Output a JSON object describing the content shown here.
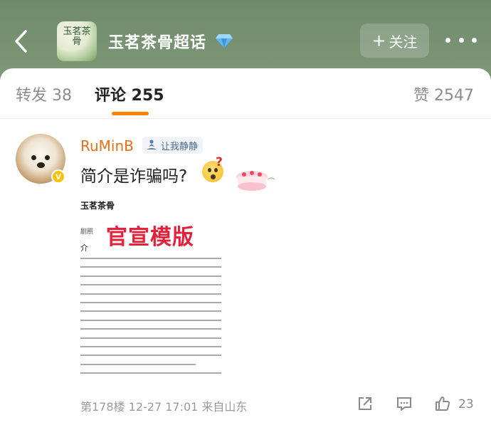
{
  "header": {
    "logo_text": "玉茗茶骨",
    "title": "玉茗茶骨超话",
    "follow_label": "关注"
  },
  "tabs": [
    {
      "label": "转发 38"
    },
    {
      "label": "评论 255"
    },
    {
      "label": "赞 2547"
    }
  ],
  "colors": {
    "accent": "#ff8200",
    "header_bg": "#76916f",
    "username": "#e86f19",
    "stamp_red": "#e4203a"
  },
  "comment": {
    "username": "RuMinB",
    "fan_badge": "让我静静",
    "text": "简介是诈骗吗?",
    "image": {
      "brand_text": "玉茗茶骨",
      "small_text": "剧照",
      "stamp_text": "官宣模版",
      "mark_text": "介"
    },
    "footer": {
      "floor": "第178楼",
      "datetime": "12-27 17:01",
      "location": "来自山东"
    },
    "like_count": "23"
  },
  "icons": {
    "back": "chevron-left-icon",
    "diamond": "diamond-icon",
    "more": "more-dots-icon",
    "fan_badge": "meditation-figure-icon",
    "share": "share-icon",
    "reply": "reply-bubble-icon",
    "like": "thumbs-up-icon"
  }
}
